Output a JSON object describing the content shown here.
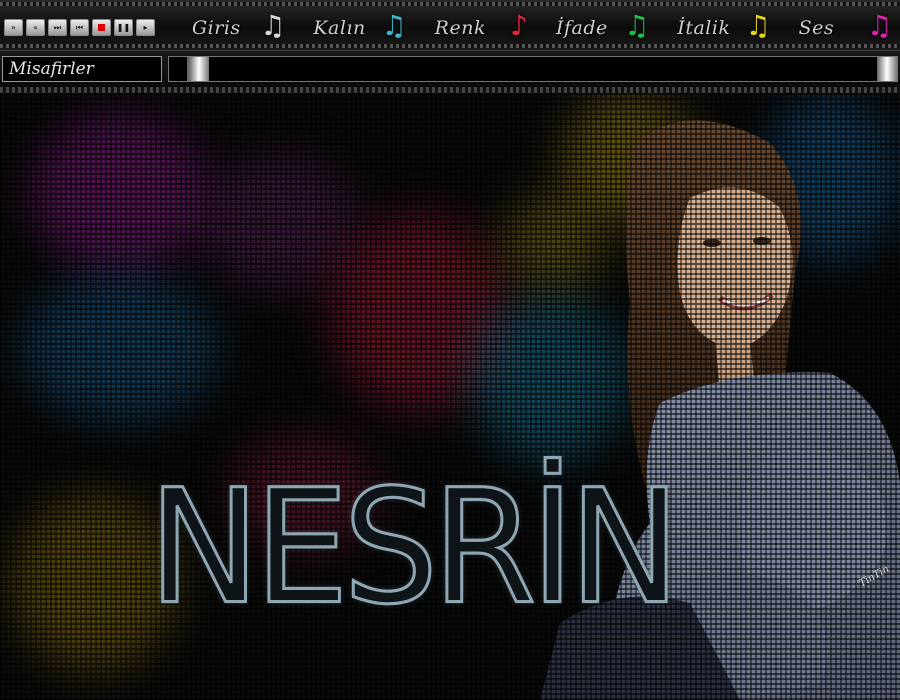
{
  "player": {
    "controls": [
      {
        "name": "fast-forward-icon",
        "glyph": "»"
      },
      {
        "name": "rewind-icon",
        "glyph": "«"
      },
      {
        "name": "next-icon",
        "glyph": "⏭"
      },
      {
        "name": "previous-icon",
        "glyph": "⏮"
      },
      {
        "name": "stop-icon",
        "glyph": ""
      },
      {
        "name": "pause-icon",
        "glyph": "❚❚"
      },
      {
        "name": "play-icon",
        "glyph": "▸"
      }
    ]
  },
  "menu": [
    {
      "label": "Giris",
      "note_color": "#d8d8d8"
    },
    {
      "label": "Kalın",
      "note_color": "#3fb3c8"
    },
    {
      "label": "Renk",
      "note_color": "#e0283a"
    },
    {
      "label": "İfade",
      "note_color": "#1fbf4a"
    },
    {
      "label": "İtalik",
      "note_color": "#e4d21e"
    },
    {
      "label": "Ses",
      "note_color": "#e020b0"
    }
  ],
  "guests": {
    "label": "Misafirler"
  },
  "banner": {
    "title": "NESRİN"
  },
  "watermark": {
    "text": "TinTin"
  }
}
